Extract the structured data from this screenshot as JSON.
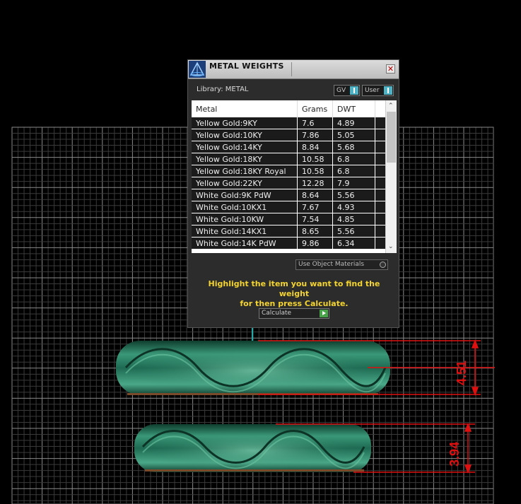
{
  "dialog": {
    "title": "METAL WEIGHTS",
    "close_glyph": "✕",
    "library_label": "Library: METAL",
    "selector_gv": "GV",
    "selector_user": "User",
    "columns": [
      "Metal",
      "Grams",
      "DWT"
    ],
    "rows": [
      [
        "Yellow Gold:9KY",
        "7.6",
        "4.89"
      ],
      [
        "Yellow Gold:10KY",
        "7.86",
        "5.05"
      ],
      [
        "Yellow Gold:14KY",
        "8.84",
        "5.68"
      ],
      [
        "Yellow Gold:18KY",
        "10.58",
        "6.8"
      ],
      [
        "Yellow Gold:18KY Royal",
        "10.58",
        "6.8"
      ],
      [
        "Yellow Gold:22KY",
        "12.28",
        "7.9"
      ],
      [
        "White Gold:9K PdW",
        "8.64",
        "5.56"
      ],
      [
        "White Gold:10KX1",
        "7.67",
        "4.93"
      ],
      [
        "White Gold:10KW",
        "7.54",
        "4.85"
      ],
      [
        "White Gold:14KX1",
        "8.65",
        "5.56"
      ],
      [
        "White Gold:14K PdW",
        "9.86",
        "6.34"
      ]
    ],
    "use_object_materials": "Use Object Materials",
    "instruction_line1": "Highlight the item you want to find the weight",
    "instruction_line2": "for then press Calculate.",
    "calculate_label": "Calculate"
  },
  "dimensions": {
    "upper_ring_height": "4.51",
    "lower_ring_height": "3.94"
  },
  "colors": {
    "ring_green": "#1f6e55",
    "dimension_red": "#e01010",
    "instruction_yellow": "#f4d430",
    "accent_teal": "#4db3c4"
  }
}
